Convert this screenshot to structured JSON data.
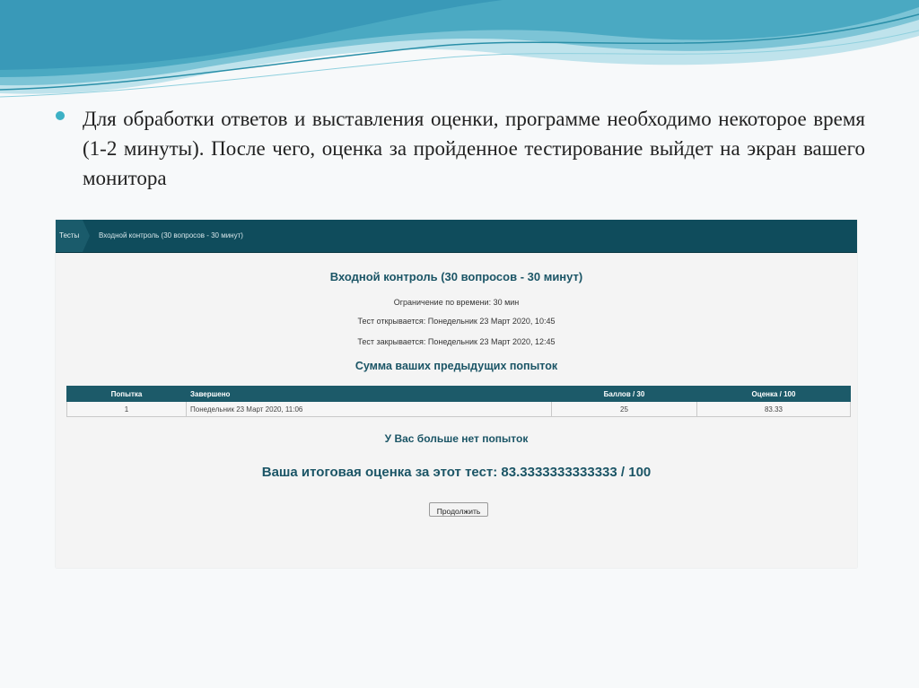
{
  "slide": {
    "paragraph": "Для обработки ответов и выставления оценки, программе необходимо некоторое время (1-2 минуты). После чего, оценка за пройденное тестирование выйдет на экран вашего монитора"
  },
  "navbar": {
    "home_label": "Тесты",
    "current_label": "Входной контроль (30 вопросов - 30 минут)"
  },
  "quiz": {
    "title": "Входной контроль (30 вопросов - 30 минут)",
    "time_limit": "Ограничение по времени: 30 мин",
    "opens": "Тест открывается: Понедельник 23 Март 2020, 10:45",
    "closes": "Тест закрывается: Понедельник 23 Март 2020, 12:45",
    "summary_title": "Сумма ваших предыдущих попыток",
    "table": {
      "headers": [
        "Попытка",
        "Завершено",
        "Баллов / 30",
        "Оценка / 100"
      ],
      "rows": [
        [
          "1",
          "Понедельник 23 Март 2020, 11:06",
          "25",
          "83.33"
        ]
      ]
    },
    "no_attempts": "У Вас больше нет попыток",
    "final_grade": "Ваша итоговая оценка за этот тест: 83.3333333333333 / 100",
    "continue_label": "Продолжить"
  },
  "colors": {
    "header": "#0f4c5c",
    "accent": "#1b5566",
    "bullet": "#3db1c5"
  }
}
